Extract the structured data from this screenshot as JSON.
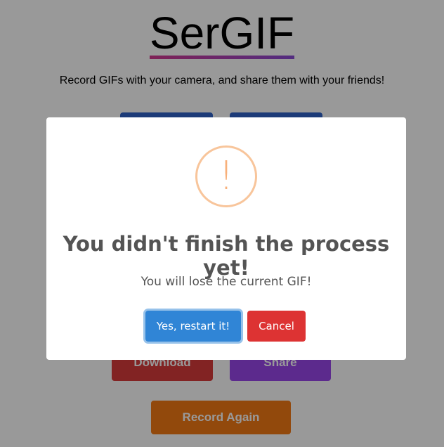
{
  "app": {
    "title": "SerGIF",
    "tagline": "Record GIFs with your camera, and share them with your friends!"
  },
  "actions": {
    "download_label": "Download",
    "share_label": "Share",
    "record_again_label": "Record Again"
  },
  "dialog": {
    "icon": "warning-exclamation",
    "icon_glyph": "!",
    "title": "You didn't finish the process yet!",
    "message": "You will lose the current GIF!",
    "confirm_label": "Yes, restart it!",
    "cancel_label": "Cancel"
  },
  "colors": {
    "confirm": "#3085d6",
    "cancel": "#dd3333",
    "download": "#d93b3b",
    "share": "#9a47ec",
    "record_again": "#f47a14",
    "warning": "#f8bb86"
  }
}
